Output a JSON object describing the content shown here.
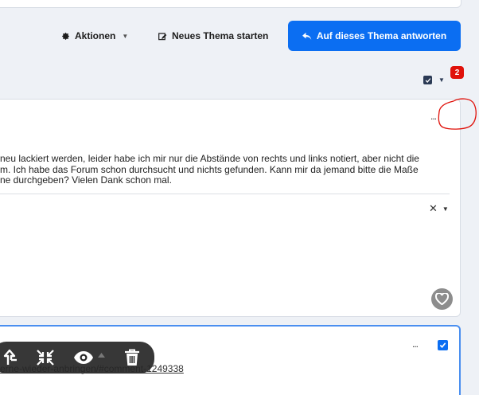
{
  "toolbar": {
    "actions_label": "Aktionen",
    "new_topic_label": "Neues Thema starten",
    "reply_label": "Auf dieses Thema antworten"
  },
  "notifications": {
    "count": "2"
  },
  "post": {
    "menu_label": "...",
    "text_lines": [
      "neu lackiert werden, leider habe ich mir nur die Abstände von rechts und links notiert, aber nicht die",
      "m. Ich habe das Forum schon durchsucht und nichts gefunden. Kann mir da jemand bitte die Maße",
      "ne durchgeben? Vielen Dank schon mal."
    ]
  },
  "comment": {
    "menu_label": "...",
    "link_text": "erne-wieder-anbringen/#comment-1249338"
  },
  "colors": {
    "accent": "#0b6ef2",
    "badge": "#e0110a",
    "annotation": "#e0110a"
  }
}
